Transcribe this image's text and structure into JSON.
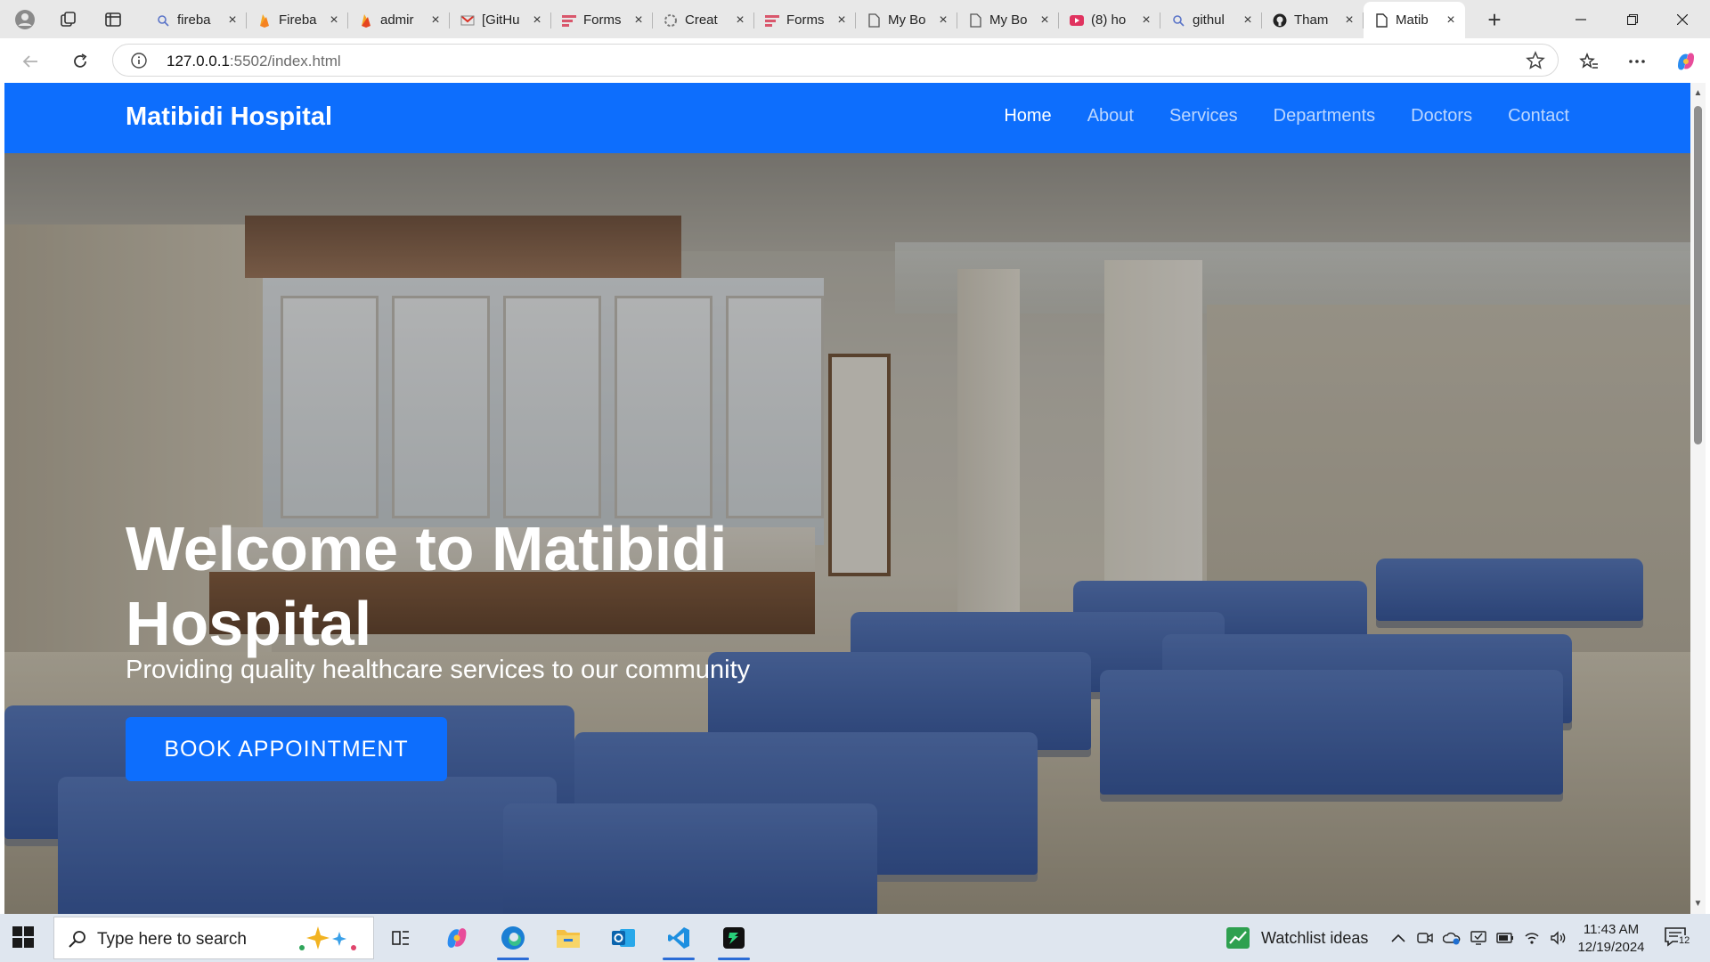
{
  "browser": {
    "tabs": [
      {
        "title": "fireba",
        "icon": "search-icon"
      },
      {
        "title": "Fireba",
        "icon": "firebase-icon"
      },
      {
        "title": "admir",
        "icon": "firebase-icon"
      },
      {
        "title": "[GitHu",
        "icon": "gmail-icon"
      },
      {
        "title": "Forms",
        "icon": "forms-icon"
      },
      {
        "title": "Creat",
        "icon": "openai-icon"
      },
      {
        "title": "Forms",
        "icon": "forms-icon"
      },
      {
        "title": "My Bo",
        "icon": "page-icon"
      },
      {
        "title": "My Bo",
        "icon": "page-icon"
      },
      {
        "title": "(8) ho",
        "icon": "youtube-icon"
      },
      {
        "title": "githul",
        "icon": "search-icon"
      },
      {
        "title": "Tham",
        "icon": "github-icon"
      },
      {
        "title": "Matib",
        "icon": "page-icon",
        "active": true
      }
    ],
    "url_host": "127.0.0.1",
    "url_path": ":5502/index.html"
  },
  "site": {
    "brand": "Matibidi Hospital",
    "nav": [
      "Home",
      "About",
      "Services",
      "Departments",
      "Doctors",
      "Contact"
    ],
    "active_nav": "Home",
    "hero": {
      "title": "Welcome to Matibidi Hospital",
      "subtitle": "Providing quality healthcare services to our community",
      "cta": "BOOK APPOINTMENT"
    },
    "colors": {
      "primary": "#0d6efd",
      "text_on_primary": "#ffffff"
    }
  },
  "taskbar": {
    "search_placeholder": "Type here to search",
    "apps": [
      "task-view-icon",
      "copilot-icon",
      "edge-icon",
      "file-explorer-icon",
      "outlook-icon",
      "vscode-icon",
      "terminal-app-icon"
    ],
    "widget_text": "Watchlist ideas",
    "time": "11:43 AM",
    "date": "12/19/2024",
    "notification_count": "12"
  }
}
